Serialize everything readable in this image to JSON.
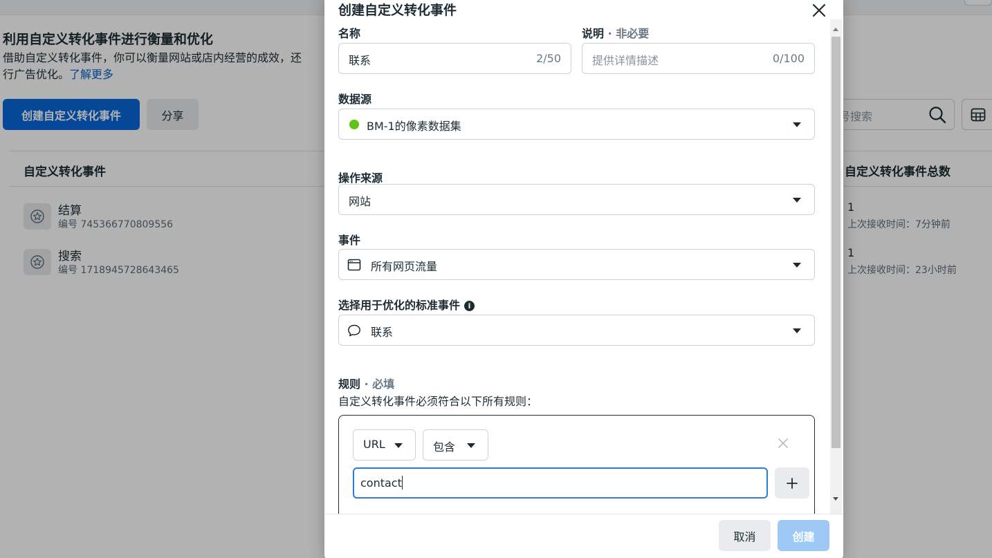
{
  "background": {
    "title": "利用自定义转化事件进行衡量和优化",
    "description_line1": "借助自定义转化事件，你可以衡量网站或店内经营的成效，还",
    "description_line2": "行广告优化。",
    "learn_more": "了解更多",
    "create_button": "创建自定义转化事件",
    "share_button": "分享",
    "search_placeholder": "号搜索",
    "table": {
      "col_name": "自定义转化事件",
      "col_total": "自定义转化事件总数",
      "rows": [
        {
          "name": "结算",
          "id": "编号 745366770809556",
          "count": "1",
          "last_received": "上次接收时间：7分钟前"
        },
        {
          "name": "搜索",
          "id": "编号 1718945728643465",
          "count": "1",
          "last_received": "上次接收时间：23小时前"
        }
      ]
    }
  },
  "dialog": {
    "title": "创建自定义转化事件",
    "name": {
      "label": "名称",
      "value": "联系",
      "counter": "2/50"
    },
    "description": {
      "label": "说明",
      "optional": " · 非必要",
      "placeholder": "提供详情描述",
      "counter": "0/100"
    },
    "data_source": {
      "label": "数据源",
      "value": "BM-1的像素数据集",
      "status_color": "#5ec41a"
    },
    "action_source": {
      "label": "操作来源",
      "value": "网站"
    },
    "event": {
      "label": "事件",
      "value": "所有网页流量"
    },
    "standard_event": {
      "label": "选择用于优化的标准事件",
      "value": "联系"
    },
    "rules": {
      "label": "规则",
      "required": " · 必填",
      "subtitle": "自定义转化事件必须符合以下所有规则：",
      "field_select": "URL",
      "operator_select": "包含",
      "input_value": "contact"
    },
    "footer": {
      "cancel": "取消",
      "create": "创建"
    }
  },
  "colors": {
    "primary": "#0a66d8",
    "primary_disabled": "#9ec8f5",
    "link": "#0a5ec9",
    "focus": "#2e7bd6"
  }
}
